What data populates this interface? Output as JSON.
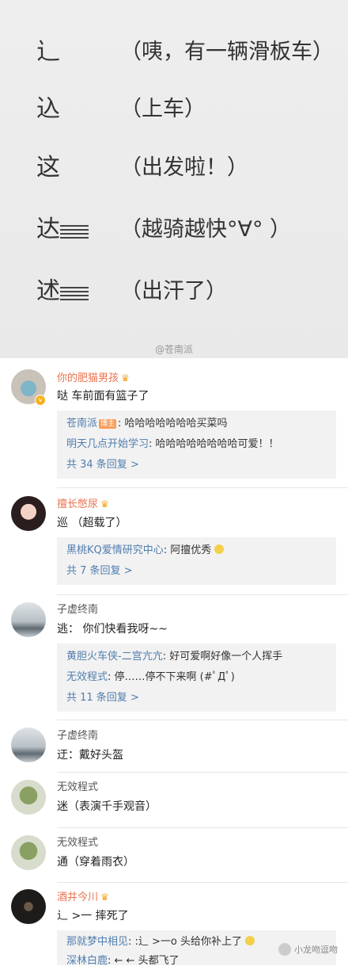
{
  "panel": {
    "lines": [
      {
        "char": "辶",
        "note": "（咦，有一辆滑板车）"
      },
      {
        "char": "込",
        "note": "（上车）"
      },
      {
        "char": "这",
        "note": "（出发啦！）"
      },
      {
        "char": "达",
        "note": "（越骑越快°∀° ）"
      },
      {
        "char": "述",
        "note": "（出汗了）"
      }
    ],
    "watermark": "@苍南派"
  },
  "comments": [
    {
      "user": "你的肥猫男孩",
      "text": "哒 车前面有篮子了",
      "replies": [
        {
          "name": "苍南派",
          "badge": "博主",
          "text": ": 哈哈哈哈哈哈哈买菜吗"
        },
        {
          "name": "明天几点开始学习",
          "text": ": 哈哈哈哈哈哈哈哈可爱！！"
        }
      ],
      "more": "共 34 条回复 >"
    },
    {
      "user": "擅长憋尿",
      "text": "巡 （超载了）",
      "replies": [
        {
          "name": "黑桃KQ爱情研究中心",
          "text": ": 阿擅优秀"
        }
      ],
      "more": "共 7 条回复 >"
    },
    {
      "user": "子虚终南",
      "text": "逃： 你们快看我呀~~",
      "replies": [
        {
          "name": "黄胆火车侠-二宫亢亢",
          "text": ": 好可爱啊好像一个人挥手"
        },
        {
          "name": "无效程式",
          "text": ": 停……停不下来啊 (#ﾟДﾟ)"
        }
      ],
      "more": "共 11 条回复 >"
    },
    {
      "user": "子虚终南",
      "text": "迂：戴好头盔"
    },
    {
      "user": "无效程式",
      "text": "迷（表演千手观音）"
    },
    {
      "user": "无效程式",
      "text": "通（穿着雨衣）"
    },
    {
      "user": "酒井今川",
      "text": "辶 >一 摔死了",
      "replies": [
        {
          "name": "那就梦中相见",
          "text": ": :辶 >一o 头给你补上了"
        },
        {
          "name": "深林白鹿",
          "text": ": ← ← 头都飞了"
        }
      ]
    }
  ],
  "bottom_watermark": "小龙吻逗吻"
}
